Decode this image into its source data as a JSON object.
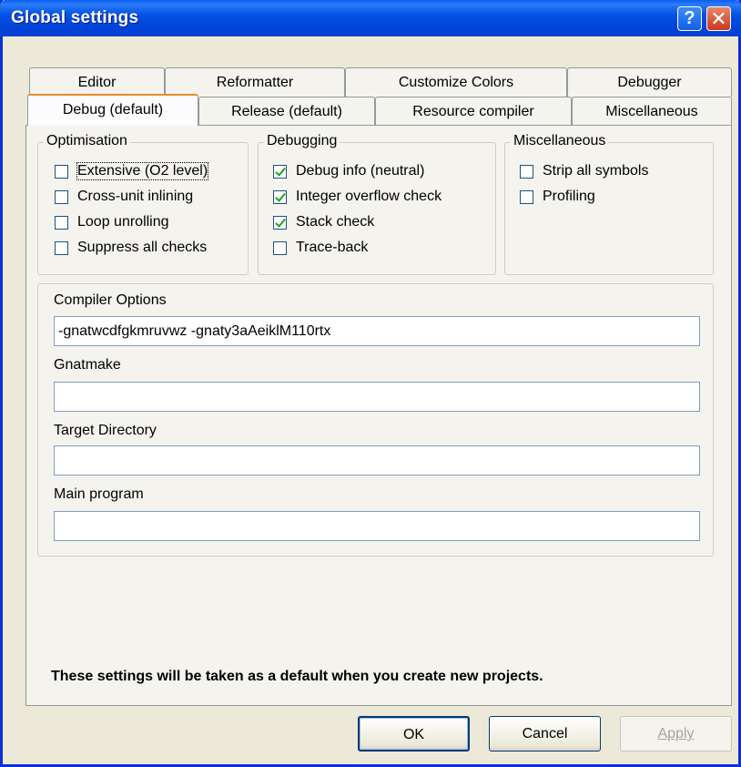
{
  "window": {
    "title": "Global settings",
    "help_glyph": "?",
    "close_glyph": "✕"
  },
  "tabs_back": [
    {
      "label": "Editor"
    },
    {
      "label": "Reformatter"
    },
    {
      "label": "Customize Colors"
    },
    {
      "label": "Debugger"
    }
  ],
  "tabs_front": [
    {
      "label": "Debug (default)",
      "active": true
    },
    {
      "label": "Release (default)",
      "active": false
    },
    {
      "label": "Resource compiler",
      "active": false
    },
    {
      "label": "Miscellaneous",
      "active": false
    }
  ],
  "optimisation": {
    "title": "Optimisation",
    "items": [
      {
        "label": "Extensive (O2 level)",
        "checked": false
      },
      {
        "label": "Cross-unit inlining",
        "checked": false
      },
      {
        "label": "Loop unrolling",
        "checked": false
      },
      {
        "label": "Suppress all checks",
        "checked": false
      }
    ]
  },
  "debugging": {
    "title": "Debugging",
    "items": [
      {
        "label": "Debug info (neutral)",
        "checked": true
      },
      {
        "label": "Integer overflow check",
        "checked": true
      },
      {
        "label": "Stack check",
        "checked": true
      },
      {
        "label": "Trace-back",
        "checked": false
      }
    ]
  },
  "misc": {
    "title": "Miscellaneous",
    "items": [
      {
        "label": "Strip all symbols",
        "checked": false
      },
      {
        "label": "Profiling",
        "checked": false
      }
    ]
  },
  "fields": {
    "compiler_options_label": "Compiler Options",
    "compiler_options_value": "-gnatwcdfgkmruvwz -gnaty3aAeiklM110rtx",
    "gnatmake_label": "Gnatmake",
    "gnatmake_value": "",
    "target_dir_label": "Target Directory",
    "target_dir_value": "",
    "main_program_label": "Main program",
    "main_program_value": ""
  },
  "note": "These settings will be taken as a default when you create new projects.",
  "buttons": {
    "ok": "OK",
    "cancel": "Cancel",
    "apply": "Apply"
  }
}
